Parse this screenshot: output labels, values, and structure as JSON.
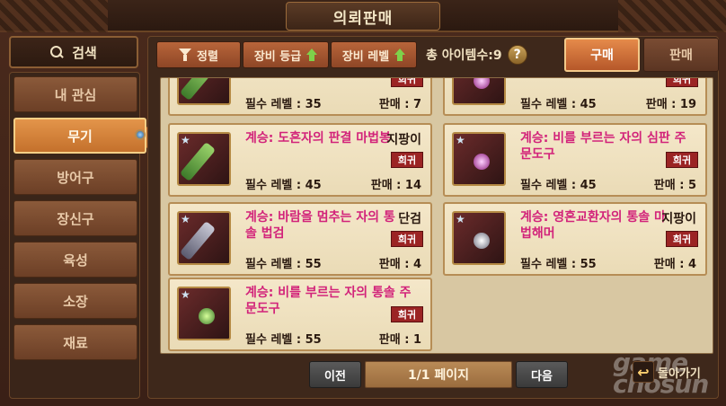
{
  "header": {
    "title": "의뢰판매"
  },
  "search": {
    "label": "검색"
  },
  "categories": [
    {
      "label": "내 관심"
    },
    {
      "label": "무기"
    },
    {
      "label": "방어구"
    },
    {
      "label": "장신구"
    },
    {
      "label": "육성"
    },
    {
      "label": "소장"
    },
    {
      "label": "재료"
    }
  ],
  "toolbar": {
    "sort_label": "정렬",
    "grade_label": "장비 등급",
    "level_label": "장비 레벨",
    "total_label": "총 아이템수:9",
    "help": "?"
  },
  "tabs": {
    "buy": "구매",
    "sell": "판매"
  },
  "items": [
    {
      "name": "",
      "type": "",
      "rarity": "희귀",
      "level": "필수 레벨 : 35",
      "price": "판매 : 7"
    },
    {
      "name": "",
      "type": "",
      "rarity": "희귀",
      "level": "필수 레벨 : 45",
      "price": "판매 : 19"
    },
    {
      "name": "계승: 도흔자의 판결 마법봉",
      "type": "지팡이",
      "rarity": "희귀",
      "level": "필수 레벨 : 45",
      "price": "판매 : 14"
    },
    {
      "name": "계승: 비를 부르는 자의 심판 주문도구",
      "type": "주문도구",
      "rarity": "희귀",
      "level": "필수 레벨 : 45",
      "price": "판매 : 5"
    },
    {
      "name": "계승: 바람을 멈추는 자의 통솔 법검",
      "type": "단검",
      "rarity": "희귀",
      "level": "필수 레벨 : 55",
      "price": "판매 : 4"
    },
    {
      "name": "계승: 영혼교환자의 통솔 마법해머",
      "type": "지팡이",
      "rarity": "희귀",
      "level": "필수 레벨 : 55",
      "price": "판매 : 4"
    },
    {
      "name": "계승: 비를 부르는 자의 통솔 주문도구",
      "type": "주문도구",
      "rarity": "희귀",
      "level": "필수 레벨 : 55",
      "price": "판매 : 1"
    }
  ],
  "pagination": {
    "prev": "이전",
    "page": "1/1 페이지",
    "next": "다음"
  },
  "back": {
    "label": "돌아가기"
  },
  "watermark": "game chosun",
  "colors": {
    "accent": "#c4712c",
    "item_name": "#d2237a",
    "rarity_bg": "#9b2424"
  }
}
